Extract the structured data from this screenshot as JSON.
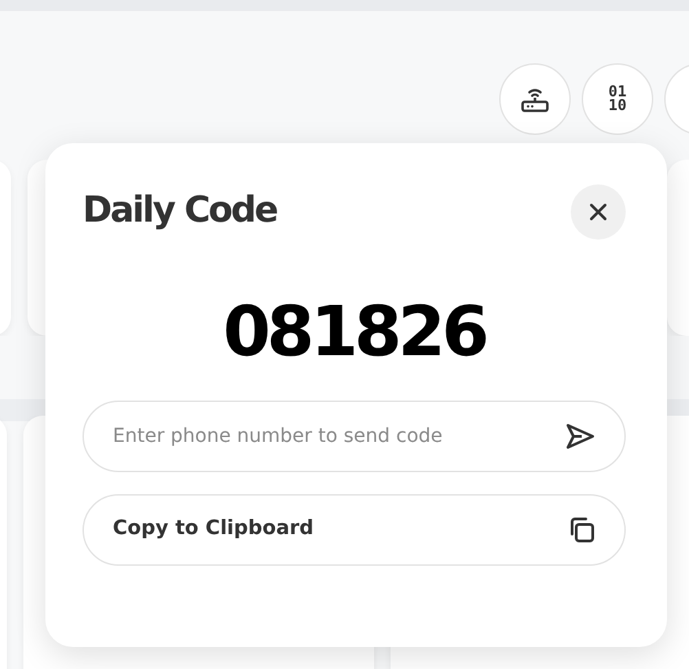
{
  "toolbar_buttons": [
    {
      "kind": "router"
    },
    {
      "kind": "binary",
      "label_lines": [
        "01",
        "10"
      ]
    },
    {
      "kind": "partial"
    }
  ],
  "dialog": {
    "title": "Daily Code",
    "code": "081826",
    "phone_field": {
      "placeholder": "Enter phone number to send code"
    },
    "copy_button": {
      "label": "Copy to Clipboard"
    }
  }
}
